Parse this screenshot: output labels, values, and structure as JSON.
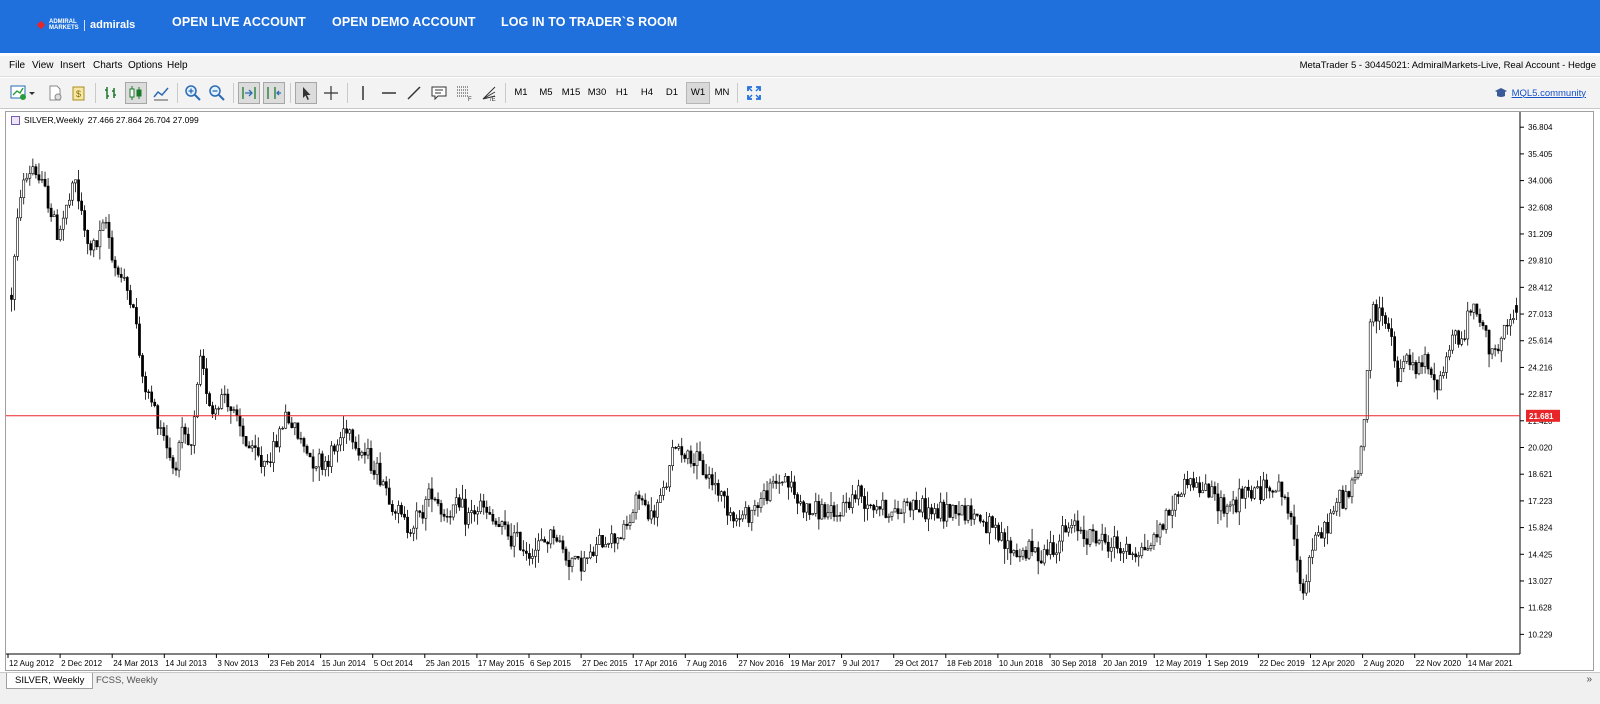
{
  "topbar": {
    "logo_small": "ADMIRAL MARKETS",
    "logo_word": "admirals",
    "nav": [
      "OPEN LIVE ACCOUNT",
      "OPEN DEMO ACCOUNT",
      "LOG IN TO TRADER`S ROOM"
    ],
    "bg_color": "#1f6fdc"
  },
  "menubar": {
    "items": [
      "File",
      "View",
      "Insert",
      "Charts",
      "Options",
      "Help"
    ],
    "window_title": "MetaTrader 5 - 30445021: AdmiralMarkets-Live, Real Account - Hedge"
  },
  "toolbar": {
    "timeframes": [
      "M1",
      "M5",
      "M15",
      "M30",
      "H1",
      "H4",
      "D1",
      "W1",
      "MN"
    ],
    "active_timeframe": "W1",
    "community_link": "MQL5.community",
    "icons": [
      "new-chart-icon",
      "new-document-icon",
      "market-icon",
      "bar-chart-icon",
      "candlestick-icon",
      "line-chart-icon",
      "zoom-in-icon",
      "zoom-out-icon",
      "autoscroll-icon",
      "chart-shift-icon",
      "cursor-icon",
      "crosshair-icon",
      "vertical-line-icon",
      "horizontal-line-icon",
      "trendline-icon",
      "text-label-icon",
      "fibonacci-grid-icon",
      "fibonacci-fan-icon",
      "fullscreen-icon"
    ]
  },
  "chart": {
    "header_symbol": "SILVER,Weekly",
    "header_ohlc": "27.466 27.864 26.704 27.099",
    "current_price_label": "21.681",
    "price_line_color": "#e8262a"
  },
  "chart_data": {
    "type": "candlestick",
    "title": "SILVER,Weekly",
    "ylim": [
      9.2,
      37.6
    ],
    "y_ticks": [
      "36.804",
      "35.405",
      "34.006",
      "32.608",
      "31.209",
      "29.810",
      "28.412",
      "27.013",
      "25.614",
      "24.216",
      "22.817",
      "21.420",
      "20.020",
      "18.621",
      "17.223",
      "15.824",
      "14.425",
      "13.027",
      "11.628",
      "10.229"
    ],
    "x_ticks": [
      "12 Aug 2012",
      "2 Dec 2012",
      "24 Mar 2013",
      "14 Jul 2013",
      "3 Nov 2013",
      "23 Feb 2014",
      "15 Jun 2014",
      "5 Oct 2014",
      "25 Jan 2015",
      "17 May 2015",
      "6 Sep 2015",
      "27 Dec 2015",
      "17 Apr 2016",
      "7 Aug 2016",
      "27 Nov 2016",
      "19 Mar 2017",
      "9 Jul 2017",
      "29 Oct 2017",
      "18 Feb 2018",
      "10 Jun 2018",
      "30 Sep 2018",
      "20 Jan 2019",
      "12 May 2019",
      "1 Sep 2019",
      "22 Dec 2019",
      "12 Apr 2020",
      "2 Aug 2020",
      "22 Nov 2020",
      "14 Mar 2021"
    ],
    "horizontal_line": 21.681,
    "close_path_anchors": [
      [
        0,
        28.0
      ],
      [
        3,
        33.5
      ],
      [
        7,
        34.8
      ],
      [
        12,
        33.0
      ],
      [
        15,
        31.2
      ],
      [
        18,
        32.5
      ],
      [
        21,
        33.9
      ],
      [
        25,
        30.5
      ],
      [
        28,
        30.6
      ],
      [
        31,
        31.8
      ],
      [
        34,
        29.5
      ],
      [
        37,
        28.6
      ],
      [
        40,
        27.6
      ],
      [
        43,
        23.5
      ],
      [
        47,
        22.0
      ],
      [
        50,
        20.8
      ],
      [
        53,
        19.0
      ],
      [
        56,
        20.5
      ],
      [
        59,
        19.8
      ],
      [
        62,
        24.5
      ],
      [
        66,
        21.9
      ],
      [
        70,
        22.9
      ],
      [
        74,
        21.2
      ],
      [
        78,
        20.0
      ],
      [
        82,
        19.2
      ],
      [
        86,
        19.8
      ],
      [
        90,
        21.8
      ],
      [
        94,
        20.6
      ],
      [
        98,
        19.6
      ],
      [
        102,
        19.2
      ],
      [
        106,
        19.8
      ],
      [
        110,
        21.3
      ],
      [
        114,
        20.0
      ],
      [
        118,
        19.3
      ],
      [
        122,
        18.3
      ],
      [
        126,
        16.8
      ],
      [
        130,
        15.9
      ],
      [
        134,
        16.4
      ],
      [
        138,
        17.9
      ],
      [
        142,
        16.5
      ],
      [
        146,
        16.9
      ],
      [
        150,
        16.4
      ],
      [
        154,
        16.9
      ],
      [
        158,
        16.1
      ],
      [
        162,
        15.6
      ],
      [
        166,
        15.1
      ],
      [
        170,
        14.6
      ],
      [
        174,
        14.9
      ],
      [
        178,
        15.6
      ],
      [
        182,
        14.3
      ],
      [
        186,
        14.0
      ],
      [
        190,
        14.2
      ],
      [
        194,
        15.2
      ],
      [
        198,
        15.3
      ],
      [
        202,
        15.8
      ],
      [
        206,
        17.5
      ],
      [
        210,
        16.3
      ],
      [
        214,
        17.6
      ],
      [
        218,
        20.2
      ],
      [
        222,
        19.6
      ],
      [
        226,
        19.0
      ],
      [
        230,
        18.3
      ],
      [
        234,
        17.3
      ],
      [
        238,
        16.2
      ],
      [
        242,
        16.6
      ],
      [
        246,
        17.3
      ],
      [
        250,
        18.0
      ],
      [
        254,
        18.5
      ],
      [
        258,
        17.2
      ],
      [
        262,
        16.6
      ],
      [
        266,
        16.8
      ],
      [
        270,
        16.2
      ],
      [
        274,
        17.2
      ],
      [
        278,
        17.6
      ],
      [
        282,
        17.2
      ],
      [
        286,
        16.9
      ],
      [
        290,
        16.4
      ],
      [
        294,
        17.3
      ],
      [
        298,
        16.9
      ],
      [
        302,
        16.6
      ],
      [
        306,
        16.6
      ],
      [
        310,
        16.9
      ],
      [
        314,
        16.7
      ],
      [
        318,
        16.3
      ],
      [
        322,
        15.6
      ],
      [
        326,
        14.9
      ],
      [
        330,
        14.5
      ],
      [
        334,
        14.6
      ],
      [
        338,
        14.5
      ],
      [
        342,
        14.9
      ],
      [
        346,
        15.6
      ],
      [
        350,
        15.9
      ],
      [
        354,
        15.4
      ],
      [
        358,
        15.1
      ],
      [
        362,
        14.9
      ],
      [
        366,
        14.6
      ],
      [
        370,
        14.6
      ],
      [
        374,
        15.0
      ],
      [
        378,
        16.1
      ],
      [
        382,
        17.3
      ],
      [
        386,
        18.4
      ],
      [
        390,
        17.9
      ],
      [
        394,
        17.6
      ],
      [
        398,
        17.0
      ],
      [
        402,
        17.1
      ],
      [
        406,
        17.7
      ],
      [
        410,
        17.8
      ],
      [
        414,
        18.1
      ],
      [
        418,
        17.4
      ],
      [
        422,
        14.4
      ],
      [
        424,
        12.5
      ],
      [
        427,
        14.9
      ],
      [
        430,
        15.4
      ],
      [
        433,
        16.4
      ],
      [
        436,
        17.3
      ],
      [
        439,
        17.6
      ],
      [
        442,
        18.6
      ],
      [
        444,
        21.5
      ],
      [
        446,
        26.8
      ],
      [
        450,
        27.2
      ],
      [
        452,
        26.3
      ],
      [
        455,
        23.5
      ],
      [
        458,
        24.8
      ],
      [
        461,
        23.8
      ],
      [
        464,
        24.6
      ],
      [
        467,
        23.2
      ],
      [
        470,
        24.1
      ],
      [
        473,
        26.0
      ],
      [
        476,
        25.5
      ],
      [
        479,
        27.3
      ],
      [
        482,
        26.6
      ],
      [
        485,
        25.5
      ],
      [
        488,
        25.1
      ],
      [
        491,
        26.2
      ],
      [
        494,
        27.1
      ]
    ],
    "last_bar": {
      "open": 27.466,
      "high": 27.864,
      "low": 26.704,
      "close": 27.099
    }
  },
  "tabs": {
    "items": [
      "SILVER, Weekly",
      "FCSS, Weekly"
    ],
    "active": 0,
    "scroll_glyph": "»"
  }
}
